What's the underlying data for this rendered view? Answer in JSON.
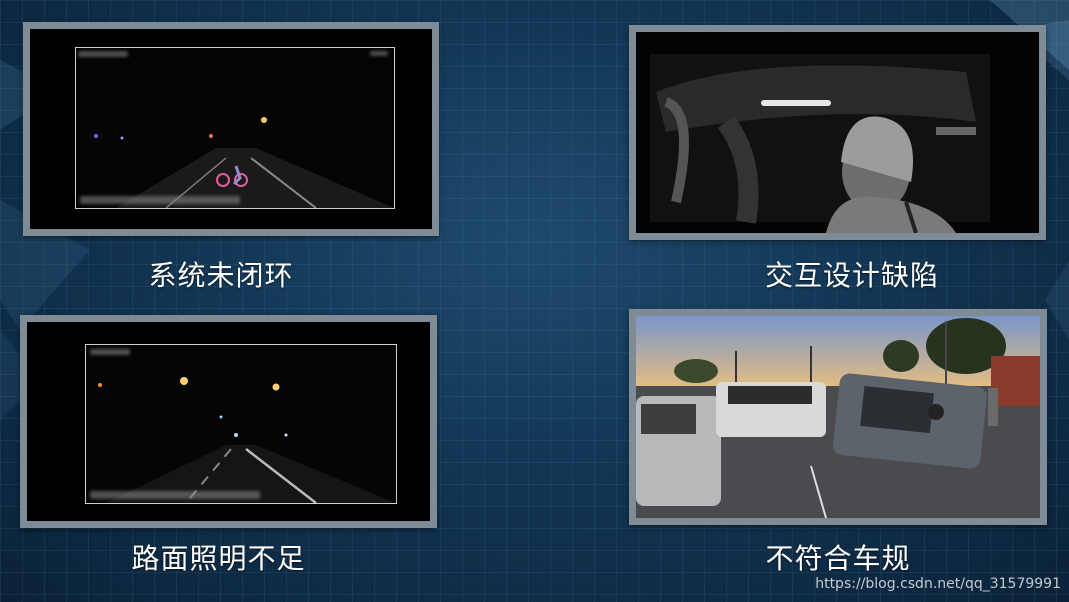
{
  "captions": {
    "top_left": "系统未闭环",
    "top_right": "交互设计缺陷",
    "bottom_left": "路面照明不足",
    "bottom_right": "不符合车规"
  },
  "watermark": "https://blog.csdn.net/qq_31579991",
  "colors": {
    "background": "#123654",
    "frame": "#7f8c96",
    "caption": "#ffffff"
  }
}
